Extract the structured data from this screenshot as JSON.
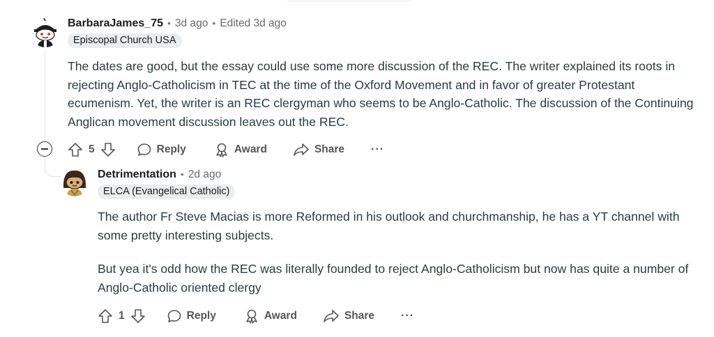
{
  "comment": {
    "username": "BarbaraJames_75",
    "time": "3d ago",
    "edited": "Edited 3d ago",
    "flair": "Episcopal Church USA",
    "body": "The dates are good, but the essay could use some more discussion of the REC. The writer explained its roots in rejecting Anglo-Catholicism in TEC at the time of the Oxford Movement and in favor of greater Protestant ecumenism. Yet, the writer is an REC clergyman who seems to be Anglo-Catholic. The discussion of the Continuing Anglican movement discussion leaves out the REC.",
    "votes": "5",
    "actions": {
      "reply": "Reply",
      "award": "Award",
      "share": "Share",
      "more": "···"
    }
  },
  "reply": {
    "username": "Detrimentation",
    "time": "2d ago",
    "flair": "ELCA (Evangelical Catholic)",
    "paragraphs": [
      "The author Fr Steve Macias is more Reformed in his outlook and churchmanship, he has a YT channel with some pretty interesting subjects.",
      "But yea it's odd how the REC was literally founded to reject Anglo-Catholicism but now has quite a number of Anglo-Catholic oriented clergy"
    ],
    "votes": "1",
    "actions": {
      "reply": "Reply",
      "award": "Award",
      "share": "Share",
      "more": "···"
    }
  },
  "icons": {
    "upvote": "upvote-arrow-icon",
    "downvote": "downvote-arrow-icon",
    "reply": "speech-bubble-icon",
    "award": "award-ribbon-icon",
    "share": "share-arrow-icon",
    "collapse": "collapse-minus-icon"
  }
}
